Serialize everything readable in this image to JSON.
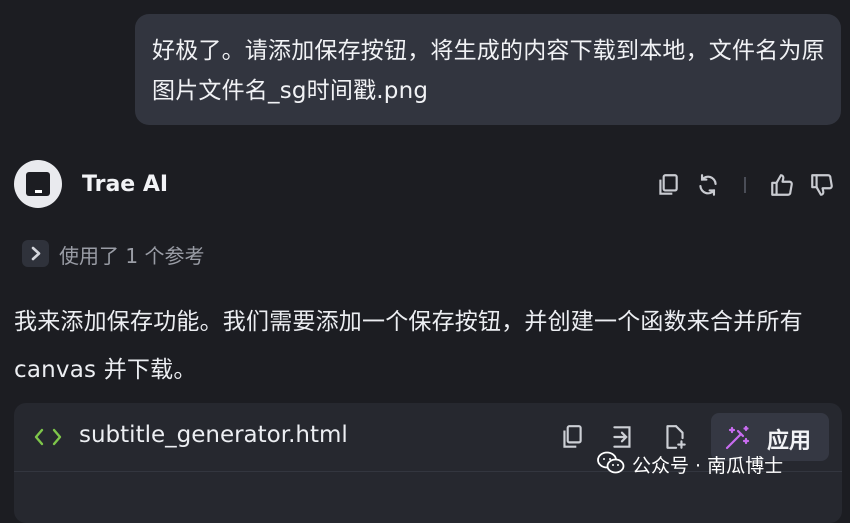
{
  "user_message": {
    "text": "好极了。请添加保存按钮，将生成的内容下载到本地，文件名为原图片文件名_sg时间戳.png"
  },
  "assistant": {
    "name": "Trae AI",
    "header_icons": [
      "copy-icon",
      "refresh-icon",
      "thumbs-up-icon",
      "thumbs-down-icon"
    ],
    "references_label": "使用了 1 个参考",
    "message": "我来添加保存功能。我们需要添加一个保存按钮，并创建一个函数来合并所有 canvas 并下载。"
  },
  "code_block": {
    "file_name": "subtitle_generator.html",
    "toolbar_icons": [
      "copy-icon",
      "insert-icon",
      "new-file-icon",
      "magic-wand-icon"
    ],
    "apply_label": "应用"
  },
  "watermark": {
    "text": "公众号 · 南瓜博士"
  },
  "colors": {
    "background": "#1c1d22",
    "bubble": "#32353f",
    "card": "#26282f",
    "accent_green": "#7ec64a",
    "accent_purple": "#c86cf0"
  }
}
